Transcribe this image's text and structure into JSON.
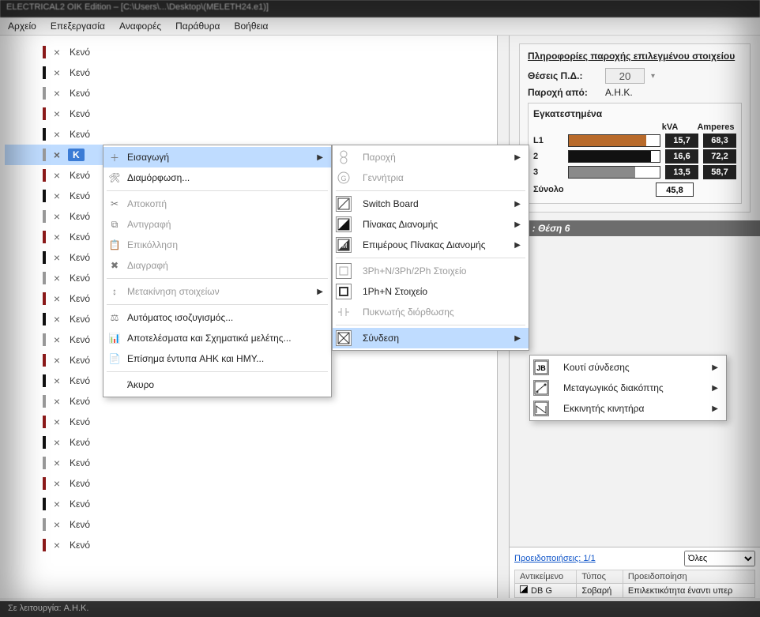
{
  "titlebar": "ELECTRICAL2 OIK Edition – [C:\\Users\\...\\Desktop\\(MELETH24.e1)]",
  "menu": {
    "file": "Αρχείο",
    "edit": "Επεξεργασία",
    "reports": "Αναφορές",
    "windows": "Παράθυρα",
    "help": "Βοήθεια"
  },
  "tree": {
    "empty_label": "Κενό",
    "selected_label": "K",
    "rows": 25,
    "selected_index": 5
  },
  "ctx1": {
    "insert": "Εισαγωγή",
    "configure": "Διαμόρφωση...",
    "cut": "Αποκοπή",
    "copy": "Αντιγραφή",
    "paste": "Επικόλληση",
    "delete": "Διαγραφή",
    "move": "Μετακίνηση στοιχείων",
    "autobalance": "Αυτόματος ισοζυγισμός...",
    "results": "Αποτελέσματα και Σχηματικά μελέτης...",
    "official": "Επίσημα έντυπα AHK και HMY...",
    "cancel": "Άκυρο"
  },
  "ctx2": {
    "supply": "Παροχή",
    "generator": "Γεννήτρια",
    "switchboard": "Switch Board",
    "distboard": "Πίνακας Διανομής",
    "subdist": "Επιμέρους Πίνακας Διανομής",
    "elem3ph": "3Ph+N/3Ph/2Ph Στοιχείο",
    "elem1ph": "1Ph+N Στοιχείο",
    "capacitor": "Πυκνωτής διόρθωσης",
    "connection": "Σύνδεση"
  },
  "ctx3": {
    "junction": "Κουτί σύνδεσης",
    "transfer": "Μεταγωγικός διακόπτης",
    "starter": "Εκκινητής κινητήρα"
  },
  "right": {
    "title": "Πληροφορίες παροχής επιλεγμένου στοιχείου",
    "positions_label": "Θέσεις Π.Δ.:",
    "positions_value": "20",
    "supply_label": "Παροχή από:",
    "supply_value": "A.H.K.",
    "installed_title": "Εγκατεστημένα",
    "hdr_kva": "kVA",
    "hdr_amp": "Amperes",
    "rows": [
      {
        "name": "L1",
        "fill": 85,
        "color": "#b86a2a",
        "kva": "15,7",
        "amp": "68,3"
      },
      {
        "name": "2",
        "fill": 90,
        "color": "#111111",
        "kva": "16,6",
        "amp": "72,2"
      },
      {
        "name": "3",
        "fill": 73,
        "color": "#8a8a8a",
        "kva": "13,5",
        "amp": "58,7"
      }
    ],
    "total_label": "Σύνολο",
    "total_value": "45,8",
    "sub_path": "DB : Θέση 6"
  },
  "warn": {
    "link": "Προειδοποιήσεις: 1/1",
    "filter": "Όλες",
    "col_obj": "Αντικείμενο",
    "col_type": "Τύπος",
    "col_warn": "Προειδοποίηση",
    "rows": [
      {
        "obj": "DB G",
        "type": "Σοβαρή",
        "warn": "Επιλεκτικότητα έναντι υπερ"
      }
    ]
  },
  "status": "Σε λειτουργία: A.H.K."
}
